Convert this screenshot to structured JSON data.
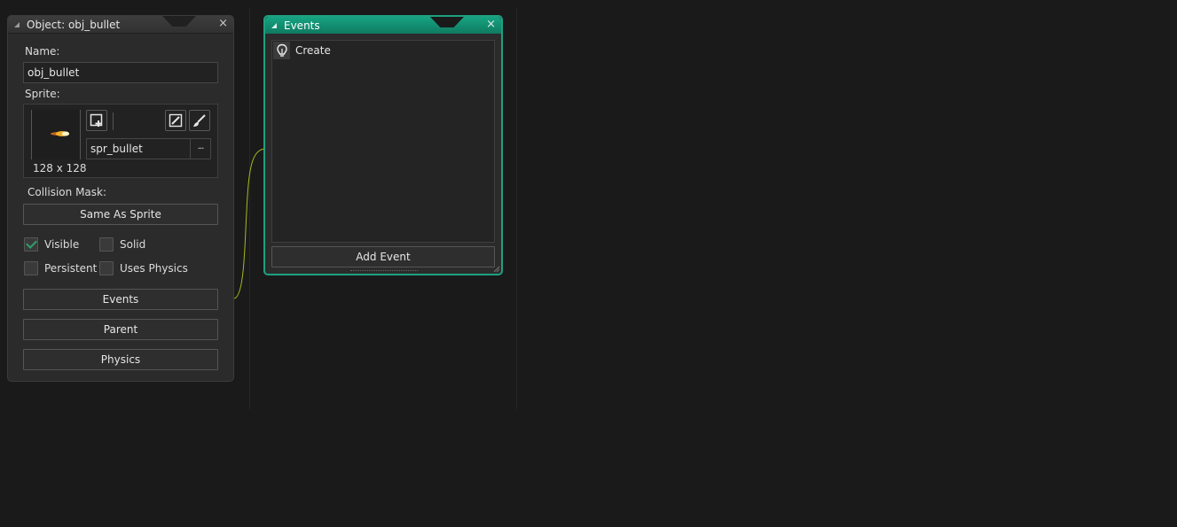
{
  "object_panel": {
    "title": "Object: obj_bullet",
    "close_glyph": "×",
    "name_label": "Name:",
    "name_value": "obj_bullet",
    "sprite_label": "Sprite:",
    "sprite_value": "spr_bullet",
    "sprite_size": "128 x 128",
    "browse_glyph": "···",
    "collision_label": "Collision Mask:",
    "collision_button": "Same As Sprite",
    "checkboxes": [
      {
        "label": "Visible",
        "checked": true
      },
      {
        "label": "Solid",
        "checked": false
      },
      {
        "label": "Persistent",
        "checked": false
      },
      {
        "label": "Uses Physics",
        "checked": false
      }
    ],
    "buttons": {
      "events": "Events",
      "parent": "Parent",
      "physics": "Physics"
    }
  },
  "events_panel": {
    "title": "Events",
    "close_glyph": "×",
    "events": [
      {
        "label": "Create",
        "icon": "lightbulb-icon"
      }
    ],
    "add_button": "Add Event"
  },
  "colors": {
    "accent": "#1ea081",
    "link_line": "#a8b81e",
    "check": "#2ea06f",
    "background": "#1a1a1a"
  }
}
